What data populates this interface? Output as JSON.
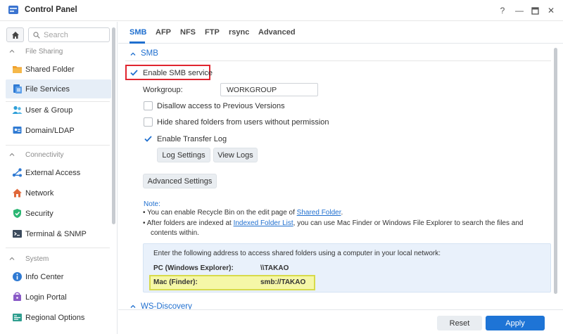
{
  "window": {
    "title": "Control Panel",
    "controls": {
      "help": "?",
      "minimize": "—",
      "maximize": "□",
      "close": "✕"
    }
  },
  "sidebar": {
    "search_placeholder": "Search",
    "sections": [
      {
        "label": "File Sharing",
        "items": [
          {
            "label": "Shared Folder",
            "icon": "folder-icon"
          },
          {
            "label": "File Services",
            "icon": "file-services-icon",
            "active": true
          }
        ]
      },
      {
        "label": "",
        "items": [
          {
            "label": "User & Group",
            "icon": "users-icon"
          },
          {
            "label": "Domain/LDAP",
            "icon": "domain-icon"
          }
        ]
      },
      {
        "label": "Connectivity",
        "items": [
          {
            "label": "External Access",
            "icon": "external-access-icon"
          },
          {
            "label": "Network",
            "icon": "network-icon"
          },
          {
            "label": "Security",
            "icon": "security-shield-icon"
          },
          {
            "label": "Terminal & SNMP",
            "icon": "terminal-icon"
          }
        ]
      },
      {
        "label": "System",
        "items": [
          {
            "label": "Info Center",
            "icon": "info-icon"
          },
          {
            "label": "Login Portal",
            "icon": "login-portal-icon"
          },
          {
            "label": "Regional Options",
            "icon": "regional-icon"
          }
        ]
      }
    ]
  },
  "tabs": [
    {
      "label": "SMB",
      "active": true
    },
    {
      "label": "AFP"
    },
    {
      "label": "NFS"
    },
    {
      "label": "FTP"
    },
    {
      "label": "rsync"
    },
    {
      "label": "Advanced"
    }
  ],
  "smb": {
    "group_title": "SMB",
    "enable_label": "Enable SMB service",
    "enable_checked": true,
    "workgroup_label": "Workgroup:",
    "workgroup_value": "WORKGROUP",
    "disallow_label": "Disallow access to Previous Versions",
    "disallow_checked": false,
    "hide_label": "Hide shared folders from users without permission",
    "hide_checked": false,
    "transfer_log_label": "Enable Transfer Log",
    "transfer_log_checked": true,
    "log_settings_label": "Log Settings",
    "view_logs_label": "View Logs",
    "advanced_settings_label": "Advanced Settings",
    "note_title": "Note:",
    "note1_prefix": "• You can enable Recycle Bin on the edit page of ",
    "note1_link": "Shared Folder",
    "note1_suffix": ".",
    "note2_prefix": "• After folders are indexed at ",
    "note2_link": "Indexed Folder List",
    "note2_suffix": ", you can use Mac Finder or Windows File Explorer to search the files and",
    "note2_cont": "contents within.",
    "info_intro": "Enter the following address to access shared folders using a computer in your local network:",
    "pc_label": "PC (Windows Explorer):",
    "pc_value": "\\\\TAKAO",
    "mac_label": "Mac (Finder):",
    "mac_value": "smb://TAKAO"
  },
  "ws_discovery": {
    "group_title": "WS-Discovery"
  },
  "footer": {
    "reset_label": "Reset",
    "apply_label": "Apply"
  },
  "colors": {
    "accent": "#1f6fcf",
    "apply": "#1e74d6",
    "highlight_red": "#e0252f",
    "highlight_yellow": "#f5f7a7"
  }
}
